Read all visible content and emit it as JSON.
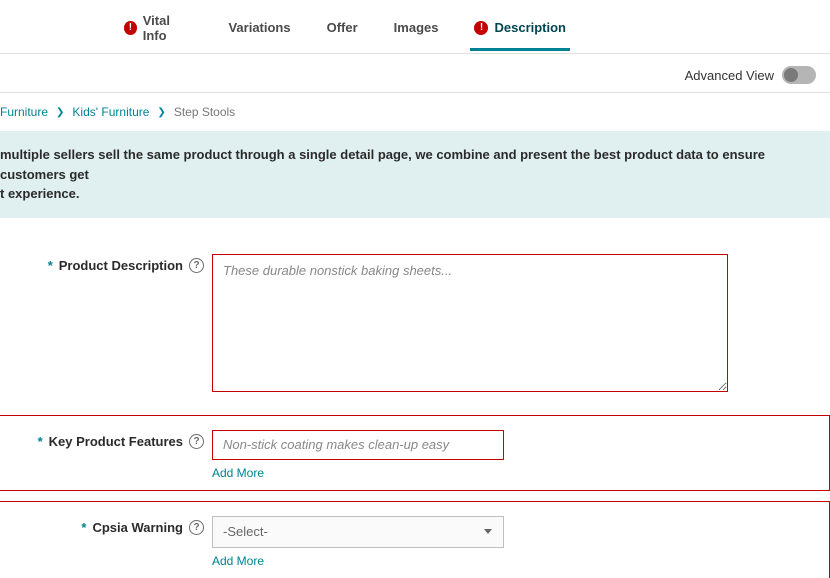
{
  "tabs": {
    "vital_info": "Vital Info",
    "variations": "Variations",
    "offer": "Offer",
    "images": "Images",
    "description": "Description"
  },
  "advanced": {
    "label": "Advanced View",
    "on": false
  },
  "breadcrumb": {
    "items": [
      "Furniture",
      "Kids' Furniture"
    ],
    "current": "Step Stools"
  },
  "banner": {
    "line1": "multiple sellers sell the same product through a single detail page, we combine and present the best product data to ensure customers get",
    "line2": "t experience."
  },
  "fields": {
    "product_description": {
      "label": "Product Description",
      "placeholder": "These durable nonstick baking sheets...",
      "required": true
    },
    "key_features": {
      "label": "Key Product Features",
      "placeholder": "Non-stick coating makes clean-up easy",
      "required": true,
      "add_more": "Add More"
    },
    "cpsia": {
      "label": "Cpsia Warning",
      "placeholder": "-Select-",
      "required": true,
      "add_more": "Add More"
    }
  },
  "glyphs": {
    "required_mark": "*",
    "help_mark": "?",
    "warn_mark": "!",
    "chevron": "❯"
  }
}
